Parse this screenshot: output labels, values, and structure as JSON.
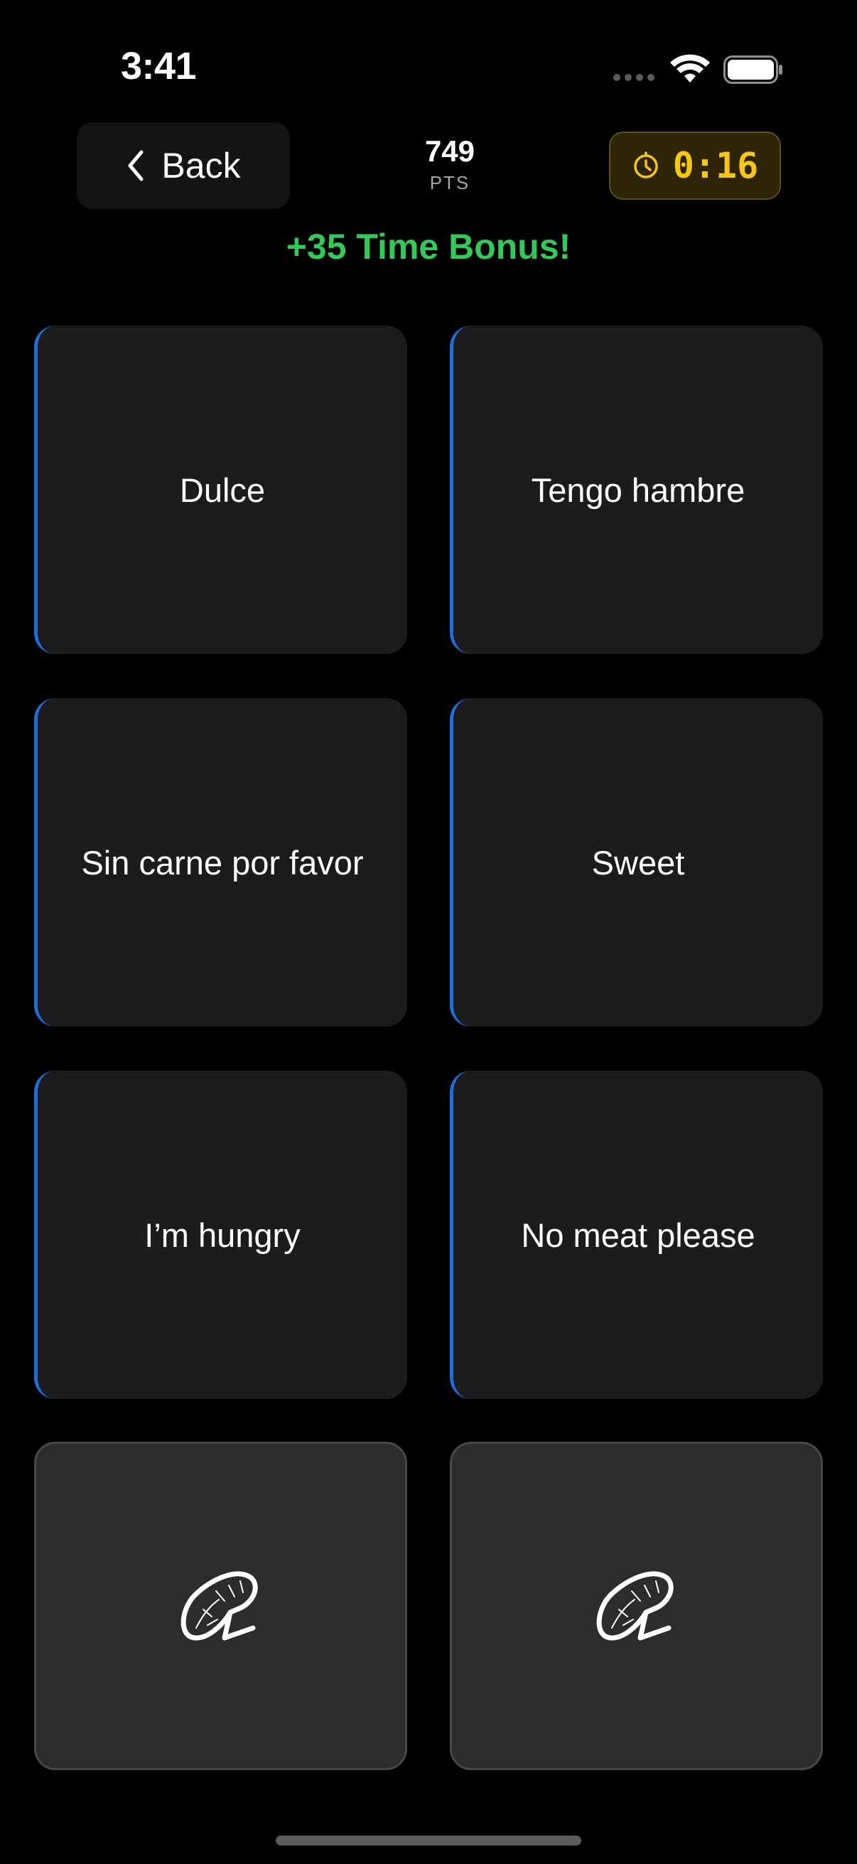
{
  "status_bar": {
    "time": "3:41"
  },
  "header": {
    "back_label": "Back",
    "score_value": "749",
    "score_unit": "PTS",
    "timer": "0:16"
  },
  "bonus_text": "+35 Time Bonus!",
  "cards": [
    {
      "text": "Dulce"
    },
    {
      "text": "Tengo hambre"
    },
    {
      "text": "Sin carne por favor"
    },
    {
      "text": "Sweet"
    },
    {
      "text": "I’m hungry"
    },
    {
      "text": "No meat please"
    }
  ],
  "hidden_cards_icon": "logo-icon",
  "colors": {
    "accent_blue": "#1e6fd9",
    "bonus_green": "#34c759",
    "timer_yellow": "#f5c518",
    "card_bg": "#1c1c1e"
  }
}
